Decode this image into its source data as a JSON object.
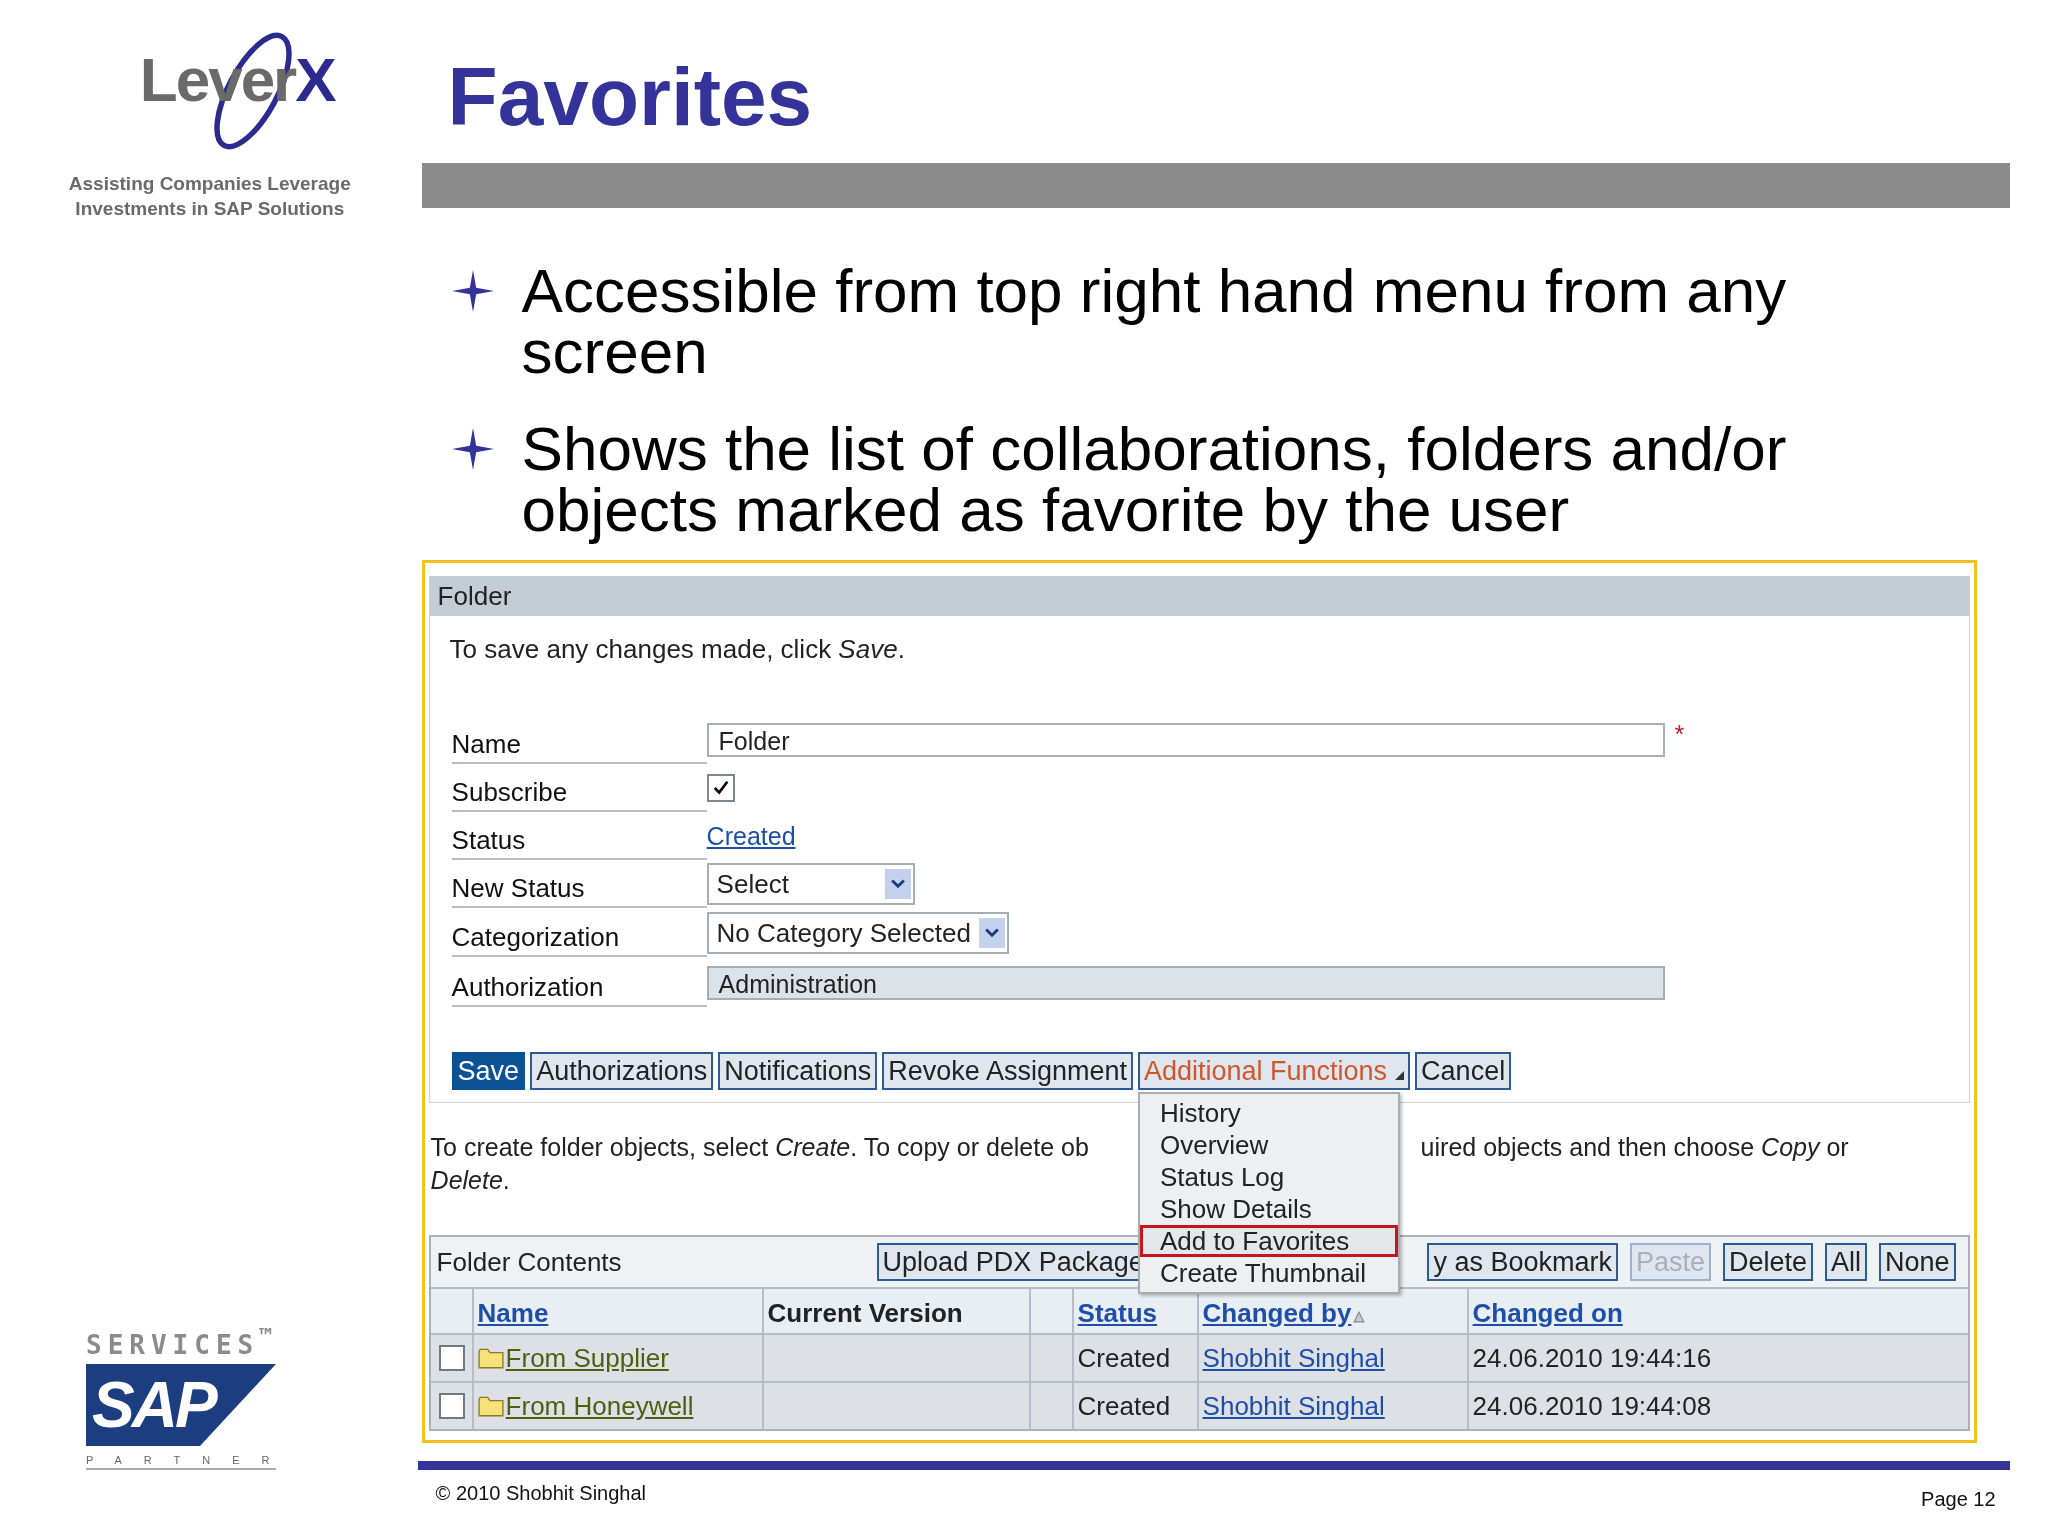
{
  "branding": {
    "logo_main": "Lever",
    "logo_accent": "X",
    "tagline": [
      "Assisting Companies Leverage",
      "Investments in SAP Solutions"
    ]
  },
  "title": "Favorites",
  "bullets": [
    "Accessible from top right hand menu from any screen",
    "Shows the list of collaborations, folders and/or objects marked as favorite by the user"
  ],
  "screenshot": {
    "panel_title": "Folder",
    "instruction": "To save any changes made, click *Save*.",
    "fields": [
      {
        "kind": "text",
        "label": "Name",
        "value": "Folder",
        "required_mark": "*"
      },
      {
        "kind": "checkbox",
        "label": "Subscribe",
        "checked": true
      },
      {
        "kind": "link",
        "label": "Status",
        "value": "Created"
      },
      {
        "kind": "select",
        "label": "New Status",
        "value": "Select"
      },
      {
        "kind": "select",
        "label": "Categorization",
        "value": "No Category Selected"
      },
      {
        "kind": "readonly",
        "label": "Authorization",
        "value": "Administration"
      }
    ],
    "buttons": [
      {
        "label": "Save",
        "kind": "primary"
      },
      {
        "label": "Authorizations",
        "kind": "normal"
      },
      {
        "label": "Notifications",
        "kind": "normal"
      },
      {
        "label": "Revoke Assignment",
        "kind": "normal"
      },
      {
        "label": "Additional Functions",
        "kind": "menu",
        "expanded": true
      },
      {
        "label": "Cancel",
        "kind": "normal"
      }
    ],
    "menu": [
      {
        "label": "History",
        "selected": false
      },
      {
        "label": "Overview",
        "selected": false
      },
      {
        "label": "Status Log",
        "selected": false
      },
      {
        "label": "Show Details",
        "selected": false
      },
      {
        "label": "Add to Favorites",
        "selected": true
      },
      {
        "label": "Create Thumbnail",
        "selected": false
      }
    ],
    "help_text": {
      "left": "To create folder objects, select *Create*. To copy or delete ob",
      "right": "uired objects and then choose *Copy* or",
      "second_line": "*Delete*."
    },
    "contents": {
      "title": "Folder Contents",
      "left_buttons": [
        {
          "label": "Upload PDX Package",
          "disabled": false
        }
      ],
      "right_buttons": [
        {
          "label": "y as Bookmark",
          "disabled": false
        },
        {
          "label": "Paste",
          "disabled": true
        },
        {
          "label": "Delete",
          "disabled": false
        },
        {
          "label": "All",
          "disabled": false
        },
        {
          "label": "None",
          "disabled": false
        }
      ],
      "columns": [
        {
          "label": "Name",
          "link": true,
          "sorted": false
        },
        {
          "label": "Current Version",
          "link": false,
          "sorted": false
        },
        {
          "label": "Status",
          "link": true,
          "sorted": false
        },
        {
          "label": "Changed by",
          "link": true,
          "sorted": true
        },
        {
          "label": "Changed on",
          "link": true,
          "sorted": false
        }
      ],
      "rows": [
        {
          "checked": false,
          "name": "From Supplier",
          "status": "Created",
          "changed_by": "Shobhit Singhal",
          "changed_on": "24.06.2010 19:44:16"
        },
        {
          "checked": false,
          "name": "From Honeywell",
          "status": "Created",
          "changed_by": "Shobhit Singhal",
          "changed_on": "24.06.2010 19:44:08"
        }
      ]
    }
  },
  "partner_logo": {
    "top": "SERVICES$^{™}$",
    "brand": "SAP",
    "bottom": "PARTNER"
  },
  "footer": {
    "copyright": "© 2010 Shobhit Singhal",
    "page": "Page 12"
  }
}
